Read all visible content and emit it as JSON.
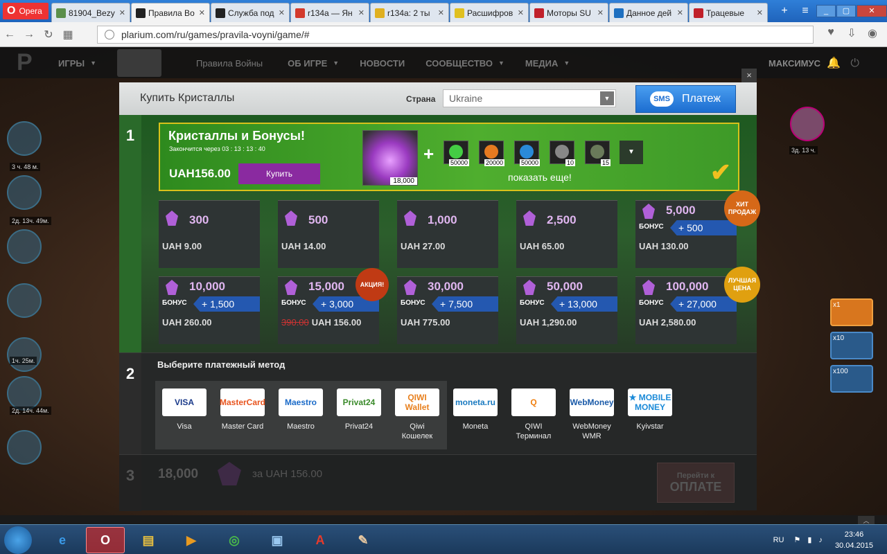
{
  "browser": {
    "opera_label": "Opera",
    "tabs": [
      {
        "label": "81904_Bezy",
        "color": "#5b8f4a",
        "active": false
      },
      {
        "label": "Правила Во",
        "color": "#222222",
        "active": true
      },
      {
        "label": "Служба под",
        "color": "#222222",
        "active": false
      },
      {
        "label": "r134a — Ян",
        "color": "#d33a2c",
        "active": false
      },
      {
        "label": "r134a: 2 ты",
        "color": "#e0b020",
        "active": false
      },
      {
        "label": "Расшифров",
        "color": "#e0c020",
        "active": false
      },
      {
        "label": "Моторы SU",
        "color": "#c0202a",
        "active": false
      },
      {
        "label": "Данное дей",
        "color": "#1e70c0",
        "active": false
      },
      {
        "label": "Трацевые",
        "color": "#c0202a",
        "active": false
      }
    ],
    "url": "plarium.com/ru/games/pravila-voyni/game/#"
  },
  "site_nav": {
    "items": [
      {
        "label": "ИГРЫ",
        "caret": true,
        "cls": "navitem"
      },
      {
        "label": "Правила Войны",
        "caret": false,
        "cls": "navitem game"
      },
      {
        "label": "ОБ ИГРЕ",
        "caret": true,
        "cls": "navitem"
      },
      {
        "label": "НОВОСТИ",
        "caret": false,
        "cls": "navitem"
      },
      {
        "label": "СООБЩЕСТВО",
        "caret": true,
        "cls": "navitem"
      },
      {
        "label": "МЕДИА",
        "caret": true,
        "cls": "navitem"
      }
    ],
    "user": "МАКСИМУС"
  },
  "game_bg": {
    "left_labels": [
      "3 ч. 48 м.",
      "2д. 13ч. 49м.",
      "1ч. 25м.",
      "2д. 14ч. 44м."
    ],
    "right_label": "3д. 13 ч.",
    "multipliers": [
      "x1",
      "x10",
      "x100"
    ]
  },
  "modal": {
    "title": "Купить Кристаллы",
    "country_label": "Страна",
    "country_value": "Ukraine",
    "sms_bubble": "SMS",
    "sms_label": "Платеж",
    "close": "×",
    "step1_num": "1",
    "step2_num": "2",
    "step3_num": "3"
  },
  "promo": {
    "title": "Кристаллы и Бонусы!",
    "ends": "Закончится через 03 : 13 : 13 : 40",
    "price": "UAH156.00",
    "buy": "Купить",
    "crystal_qty": "18,000",
    "plus": "+",
    "bonuses": [
      {
        "qty": "50000",
        "icon": "radiation-icon",
        "color": "#4c4"
      },
      {
        "qty": "20000",
        "icon": "titanium-icon",
        "color": "#e67a20"
      },
      {
        "qty": "50000",
        "icon": "dollar-icon",
        "color": "#2a8ad8"
      },
      {
        "qty": "10",
        "icon": "aircraft-icon",
        "color": "#888"
      },
      {
        "qty": "15",
        "icon": "tank-icon",
        "color": "#6a7a5a"
      }
    ],
    "show_more": "показать еще!",
    "check": "✔"
  },
  "packages": [
    {
      "amount": "300",
      "price": "UAH 9.00"
    },
    {
      "amount": "500",
      "price": "UAH 14.00"
    },
    {
      "amount": "1,000",
      "price": "UAH 27.00"
    },
    {
      "amount": "2,500",
      "price": "UAH 65.00"
    },
    {
      "amount": "5,000",
      "bonus": "+ 500",
      "price": "UAH 130.00",
      "badge": "ХИТ ПРОДАЖ",
      "badge_color": "#d66818"
    },
    {
      "amount": "10,000",
      "bonus": "+ 1,500",
      "price": "UAH 260.00"
    },
    {
      "amount": "15,000",
      "bonus": "+ 3,000",
      "price": "UAH 156.00",
      "old_price": "390.00",
      "badge": "АКЦИЯ!",
      "badge_color": "#c03a14"
    },
    {
      "amount": "30,000",
      "bonus": "+ 7,500",
      "price": "UAH 775.00"
    },
    {
      "amount": "50,000",
      "bonus": "+ 13,000",
      "price": "UAH 1,290.00"
    },
    {
      "amount": "100,000",
      "bonus": "+ 27,000",
      "price": "UAH 2,580.00",
      "badge": "ЛУЧШАЯ ЦЕНА",
      "badge_color": "#e0a010"
    }
  ],
  "bonus_label": "БОНУС",
  "payment": {
    "title": "Выберите платежный метод",
    "methods": [
      {
        "logo": "VISA",
        "name": "Visa",
        "color": "#1a3a8a"
      },
      {
        "logo": "MasterCard",
        "name": "Master Card",
        "color": "#e8541e"
      },
      {
        "logo": "Maestro",
        "name": "Maestro",
        "color": "#1a6ac8"
      },
      {
        "logo": "Privat24",
        "name": "Privat24",
        "color": "#3a8a2a"
      },
      {
        "logo": "QIWI Wallet",
        "name": "Qiwi Кошелек",
        "color": "#e8801e"
      },
      {
        "logo": "moneta.ru",
        "name": "Moneta",
        "color": "#1a7ac0"
      },
      {
        "logo": "Q",
        "name": "QIWI Терминал",
        "color": "#f08010"
      },
      {
        "logo": "WebMoney",
        "name": "WebMoney WMR",
        "color": "#1a5aa8"
      },
      {
        "logo": "★ MOBILE MONEY",
        "name": "Kyivstar",
        "color": "#1a8ad8"
      }
    ]
  },
  "summary": {
    "amount": "18,000",
    "for_price": "за UAH 156.00",
    "pay_small": "Перейти к",
    "pay_big": "ОПЛАТЕ"
  },
  "taskbar": {
    "lang": "RU",
    "time": "23:46",
    "date": "30.04.2015"
  }
}
